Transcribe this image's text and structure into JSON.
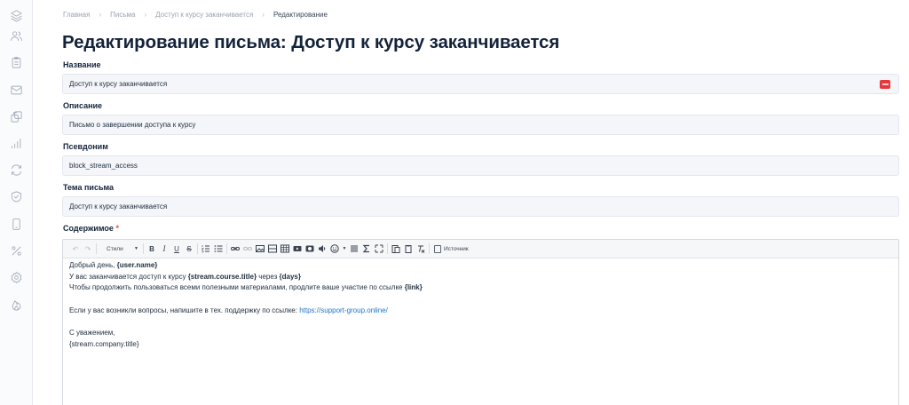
{
  "sidebar": {
    "items": [
      {
        "icon": "layers-icon"
      },
      {
        "icon": "users-icon"
      },
      {
        "icon": "clipboard-icon"
      },
      {
        "icon": "mail-icon"
      },
      {
        "icon": "copies-icon"
      },
      {
        "icon": "bar-chart-icon"
      },
      {
        "icon": "sync-icon"
      },
      {
        "icon": "shield-check-icon"
      },
      {
        "icon": "smartphone-icon"
      },
      {
        "icon": "percent-icon"
      },
      {
        "icon": "settings-icon"
      },
      {
        "icon": "flame-icon"
      }
    ]
  },
  "breadcrumb": {
    "items": [
      "Главная",
      "Письма",
      "Доступ к курсу заканчивается",
      "Редактирование"
    ],
    "separator": "›"
  },
  "page": {
    "title": "Редактирование письма: Доступ к курсу заканчивается"
  },
  "form": {
    "name": {
      "label": "Название",
      "value": "Доступ к курсу заканчивается"
    },
    "description": {
      "label": "Описание",
      "value": "Письмо о завершении доступа к курсу"
    },
    "alias": {
      "label": "Псевдоним",
      "value": "block_stream_access"
    },
    "subject": {
      "label": "Тема письма",
      "value": "Доступ к курсу заканчивается"
    },
    "content": {
      "label": "Содержимое",
      "required_mark": "*",
      "toolbar": {
        "undo": "↶",
        "redo": "↷",
        "styles_label": "Стили",
        "bold": "B",
        "italic": "I",
        "underline": "U",
        "strike": "S",
        "source_label": "Источник"
      },
      "body": {
        "line1_prefix": "Добрый день, ",
        "line1_var": "{user.name}",
        "line2_prefix": "У вас заканчивается доступ к курсу ",
        "line2_var1": "{stream.course.title}",
        "line2_mid": " через ",
        "line2_var2": "{days}",
        "line3_prefix": "Чтобы продолжить пользоваться всеми полезными материалами, продлите ваше участие по ссылке ",
        "line3_var": "{link}",
        "line4_prefix": "Если у вас возникли вопросы, напишите в тех. поддержку по ссылке: ",
        "line4_link": "https://support-group.online/",
        "line5": "С уважением,",
        "line6": "{stream.company.title}"
      }
    }
  },
  "colors": {
    "accent_link": "#1f73c9",
    "required": "#e5484d",
    "title": "#14233a",
    "badge": "#e6393b"
  }
}
